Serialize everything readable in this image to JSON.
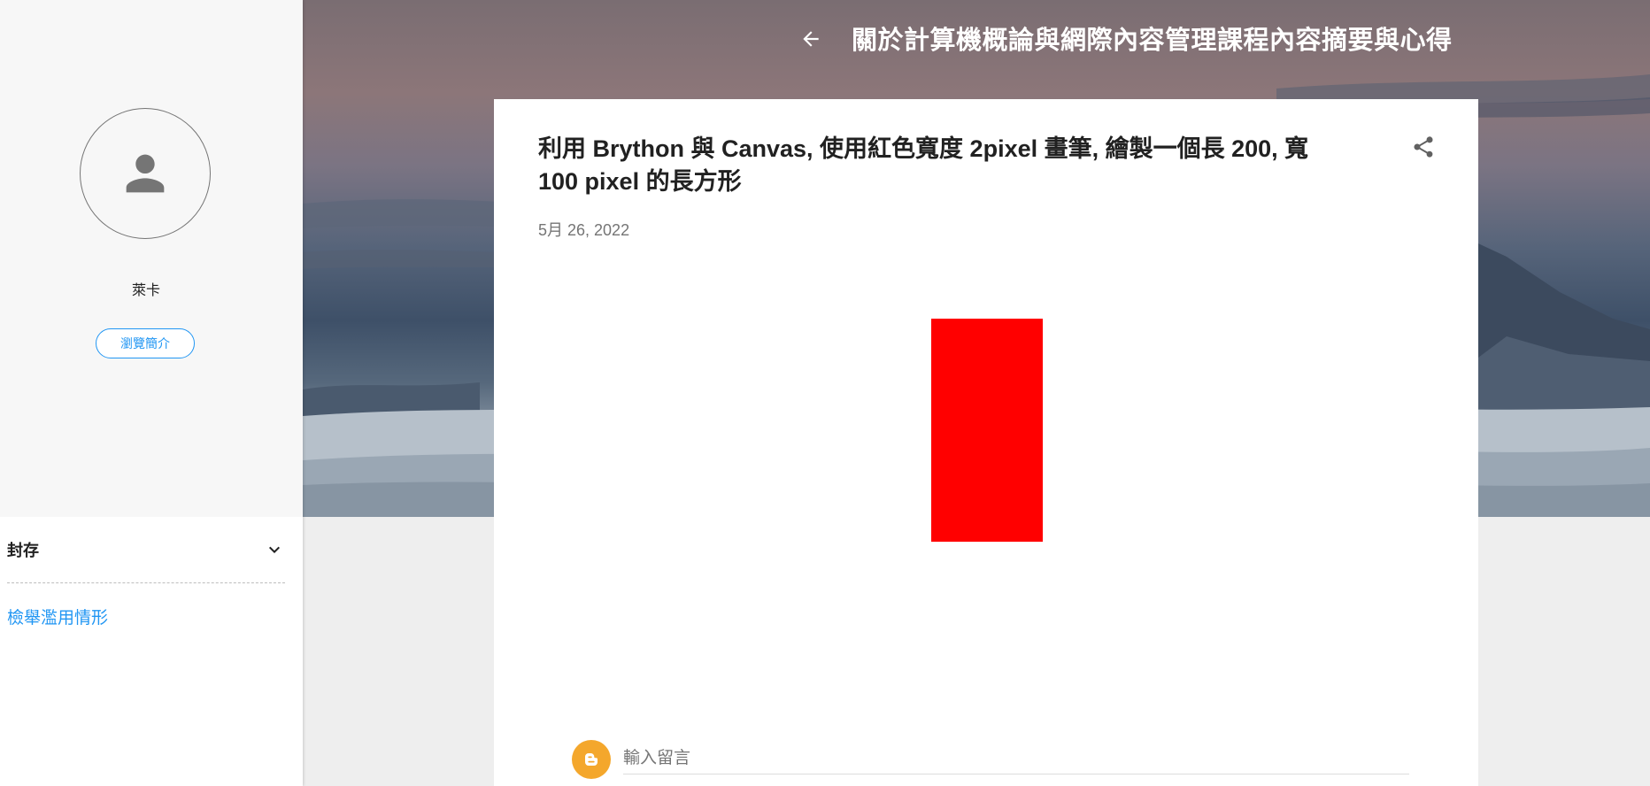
{
  "header": {
    "back_icon": "arrow-left-icon",
    "blog_title": "關於計算機概論與網際內容管理課程內容摘要與心得",
    "search_icon": "search-icon"
  },
  "sidebar": {
    "avatar_icon": "person-icon",
    "profile_name": "萊卡",
    "visit_profile_label": "瀏覽簡介",
    "archive_label": "封存",
    "archive_icon": "chevron-down-icon",
    "report_abuse_label": "檢舉濫用情形"
  },
  "post": {
    "title": "利用 Brython 與 Canvas, 使用紅色寬度 2pixel 畫筆, 繪製一個長 200, 寬 100 pixel 的長方形",
    "date": "5月 26, 2022",
    "share_icon": "share-icon",
    "rect_color": "#ff0000"
  },
  "comments": {
    "icon": "blogger-icon",
    "placeholder": "輸入留言",
    "icon_color": "#f4a72c"
  },
  "colors": {
    "accent": "#2196f3",
    "sidebar_bg": "#f7f7f7",
    "page_bg": "#eeeeee"
  }
}
